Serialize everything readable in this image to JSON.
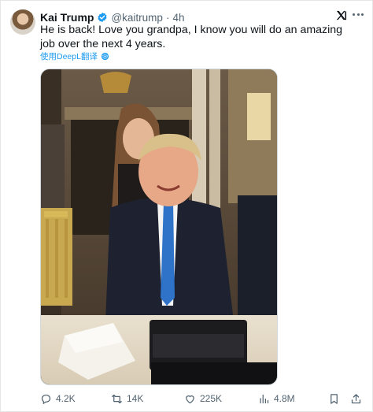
{
  "tweet": {
    "display_name": "Kai Trump",
    "handle": "@kaitrump",
    "separator": "·",
    "time": "4h",
    "text": "He is back! Love you grandpa, I know you will do an amazing job over the next 4 years.",
    "translate_label": "使用DeepL翻译"
  },
  "icons": {
    "verified": "verified-badge-icon",
    "x_logo": "x-logo-icon",
    "more": "more-icon",
    "translate": "gear-icon",
    "reply": "reply-icon",
    "retweet": "retweet-icon",
    "like": "heart-icon",
    "views": "views-icon",
    "bookmark": "bookmark-icon",
    "share": "share-icon"
  },
  "actions": {
    "reply_count": "4.2K",
    "retweet_count": "14K",
    "like_count": "225K",
    "view_count": "4.8M"
  },
  "colors": {
    "text": "#0f1419",
    "secondary": "#536471",
    "accent": "#1d9bf0"
  }
}
